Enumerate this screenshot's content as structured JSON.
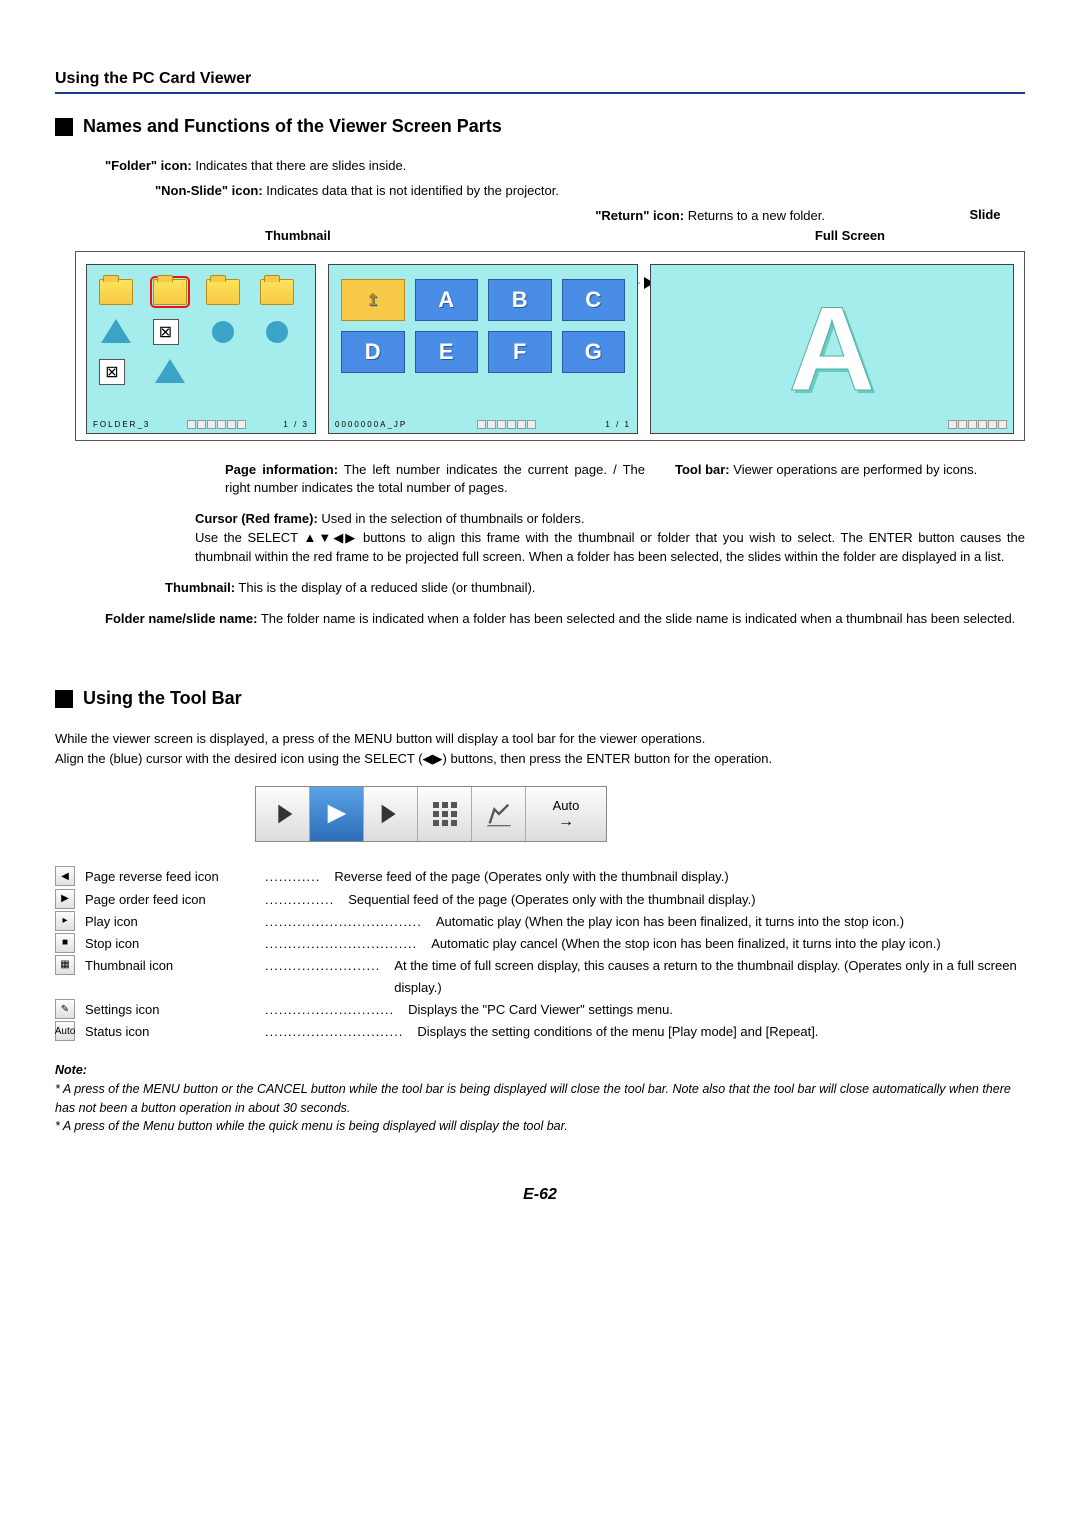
{
  "header": "Using the PC Card Viewer",
  "title1": "Names and Functions of the Viewer Screen Parts",
  "callouts": {
    "folder": "\"Folder\" icon: Indicates that there are slides inside.",
    "folder_b": "\"Folder\" icon:",
    "folder_t": " Indicates that there are slides inside.",
    "nonslide_b": "\"Non-Slide\" icon:",
    "nonslide_t": " Indicates data that is not identified by the projector.",
    "return_b": "\"Return\" icon:",
    "return_t": " Returns to a new folder.",
    "thumbnail": "Thumbnail",
    "fullscreen": "Full Screen",
    "slide": "Slide"
  },
  "panes": {
    "left_name": "FOLDER_3",
    "left_page": "1 / 3",
    "mid_name": "0000000A_JP",
    "mid_page": "1 / 1",
    "letters": [
      "A",
      "B",
      "C",
      "D",
      "E",
      "F",
      "G"
    ],
    "big": "A"
  },
  "desc": {
    "pageinfo_b": "Page information:",
    "pageinfo_t": " The left number indicates the current page. / The right number indicates the total number of pages.",
    "toolbar_b": "Tool bar:",
    "toolbar_t": " Viewer operations are performed by icons.",
    "cursor_b": "Cursor (Red frame):",
    "cursor_t": " Used in the selection of thumbnails or folders.\nUse the SELECT ▲▼◀▶ buttons to align this frame with the thumbnail or folder that you wish to select. The ENTER button causes the thumbnail within the red frame to be projected full screen. When a folder has been selected, the slides within the folder are displayed in a list.",
    "thumb_b": "Thumbnail:",
    "thumb_t": " This is the display of a reduced slide (or thumbnail).",
    "fname_b": "Folder name/slide name:",
    "fname_t": " The folder name is indicated when a folder has been selected and the slide name is indicated when a thumbnail has been selected."
  },
  "title2": "Using the Tool Bar",
  "intro1": "While the viewer screen is displayed, a press of the MENU button will display a tool bar for the viewer operations.",
  "intro2": "Align the (blue) cursor with the desired icon using the SELECT (◀▶) buttons, then press the ENTER button for the operation.",
  "toolbar_auto": "Auto",
  "icons": [
    {
      "g": "◀",
      "n": "Page reverse feed icon",
      "d": "............",
      "t": "Reverse feed of the page (Operates only with the thumbnail display.)"
    },
    {
      "g": "▶",
      "n": "Page order feed icon",
      "d": "...............",
      "t": "Sequential feed of the page (Operates only with the thumbnail display.)"
    },
    {
      "g": "▸",
      "n": "Play icon",
      "d": "..................................",
      "t": "Automatic play (When the play icon has been finalized, it turns into the stop icon.)"
    },
    {
      "g": "■",
      "n": "Stop icon",
      "d": ".................................",
      "t": "Automatic play cancel (When the stop icon has been finalized, it turns into the play icon.)"
    },
    {
      "g": "▦",
      "n": "Thumbnail icon",
      "d": ".........................",
      "t": "At the time of full screen display, this causes a return to the thumbnail display. (Operates only in a full screen display.)"
    },
    {
      "g": "✎",
      "n": "Settings icon",
      "d": "............................",
      "t": "Displays the \"PC Card Viewer\" settings menu."
    },
    {
      "g": "Auto",
      "n": "Status icon",
      "d": "..............................",
      "t": "Displays the setting conditions of the menu [Play mode] and [Repeat]."
    }
  ],
  "note_h": "Note:",
  "note1": "* A press of the MENU button or the CANCEL button while the tool bar is being displayed will close the tool bar. Note also that the tool bar will close automatically when there has not been a button operation in about 30 seconds.",
  "note2": "* A press of the Menu button while the quick menu is being displayed will display the tool bar.",
  "pagenum": "E-62"
}
